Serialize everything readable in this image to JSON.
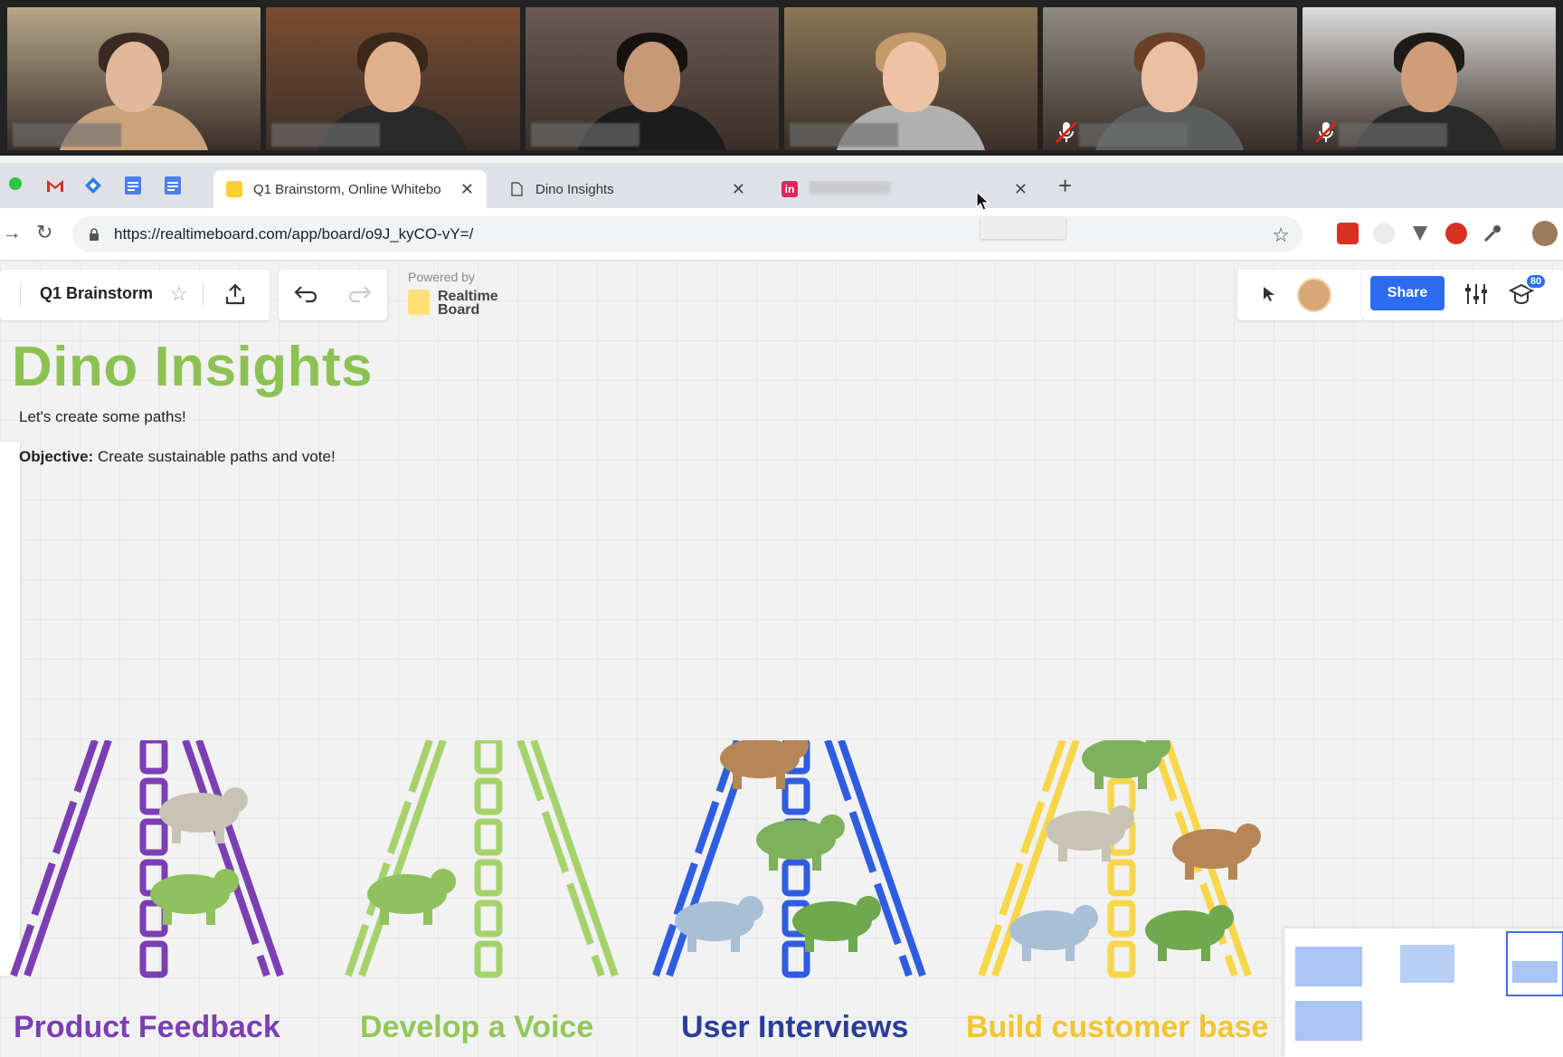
{
  "video_call": {
    "participants": [
      {
        "id": "p1",
        "active": true,
        "muted": false,
        "bg": "#b7a58a",
        "skin": "#e2b89a",
        "hair": "#3a2a22",
        "shirt": "#c9a37c"
      },
      {
        "id": "p2",
        "active": false,
        "muted": false,
        "bg": "#7a4e32",
        "skin": "#e0b08c",
        "hair": "#3b2819",
        "shirt": "#2a2a2a"
      },
      {
        "id": "p3",
        "active": false,
        "muted": false,
        "bg": "#6b5a56",
        "skin": "#c99874",
        "hair": "#15120f",
        "shirt": "#1c1c1c"
      },
      {
        "id": "p4",
        "active": false,
        "muted": false,
        "bg": "#8b7757",
        "skin": "#eec3a3",
        "hair": "#c49a6a",
        "shirt": "#b0b0b0"
      },
      {
        "id": "p5",
        "active": false,
        "muted": true,
        "bg": "#8e8a82",
        "skin": "#ebc0a2",
        "hair": "#6a4028",
        "shirt": "#5b5e5c"
      },
      {
        "id": "p6",
        "active": false,
        "muted": true,
        "bg": "#dcdcdc",
        "skin": "#d09c7a",
        "hair": "#1e1a18",
        "shirt": "#2a2a2a"
      }
    ]
  },
  "browser": {
    "tabs": [
      {
        "title": "Q1 Brainstorm, Online Whitebo",
        "active": true,
        "favicon_color": "#ffd02f"
      },
      {
        "title": "Dino Insights",
        "active": false,
        "favicon_color": "#ffffff"
      },
      {
        "title": "",
        "active": false,
        "favicon_color": "#e0245e"
      }
    ],
    "url": "https://realtimeboard.com/app/board/o9J_kyCO-vY=/"
  },
  "board": {
    "name": "Q1 Brainstorm",
    "powered_by": "Powered by",
    "brand": "Realtime Board",
    "share_label": "Share",
    "notification_count": "80",
    "heading": "Dino Insights",
    "subtext": "Let's create some paths!",
    "objective_label": "Objective:",
    "objective_text": "Create sustainable paths and vote!",
    "paths": [
      {
        "label": "Product Feedback",
        "color": "#7b3fb3"
      },
      {
        "label": "Develop a Voice",
        "color": "#92c85a"
      },
      {
        "label": "User Interviews",
        "color": "#2b3d98"
      },
      {
        "label": "Build customer base",
        "color": "#f2c531"
      }
    ]
  },
  "colors": {
    "accent": "#2d6cf0",
    "heading_green": "#8cc253"
  }
}
